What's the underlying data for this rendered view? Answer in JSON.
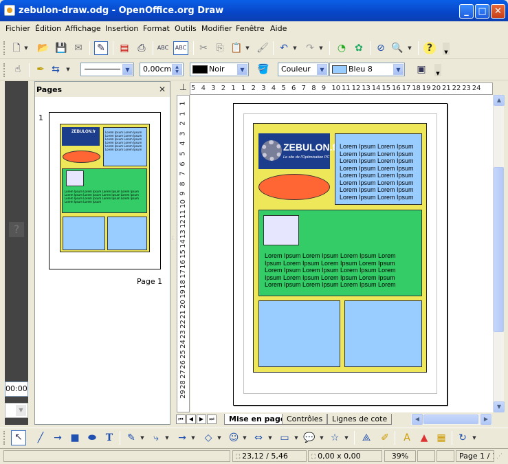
{
  "window": {
    "title": "zebulon-draw.odg - OpenOffice.org Draw",
    "buttons": {
      "minimize": "_",
      "maximize": "□",
      "close": "✕"
    }
  },
  "menu": [
    "Fichier",
    "Édition",
    "Affichage",
    "Insertion",
    "Format",
    "Outils",
    "Modifier",
    "Fenêtre",
    "Aide"
  ],
  "line_toolbar": {
    "line_width": "0,00cm",
    "line_color": {
      "label": "Noir",
      "color": "#000000"
    },
    "fill_type": "Couleur",
    "fill_color": {
      "label": "Bleu 8",
      "color": "#99ccff"
    }
  },
  "left_panel": {
    "partial_value": "00:00"
  },
  "pages_panel": {
    "title": "Pages",
    "close": "✕",
    "page_number": "1",
    "page_label": "Page 1"
  },
  "rulers": {
    "horizontal": [
      "5",
      "4",
      "3",
      "2",
      "1",
      "1",
      "2",
      "3",
      "4",
      "5",
      "6",
      "7",
      "8",
      "9",
      "10",
      "11",
      "12",
      "13",
      "14",
      "15",
      "16",
      "17",
      "18",
      "19",
      "20",
      "21",
      "22",
      "23",
      "24"
    ],
    "vertical": [
      "1",
      "1",
      "2",
      "3",
      "4",
      "5",
      "6",
      "7",
      "8",
      "9",
      "10",
      "11",
      "12",
      "13",
      "14",
      "15",
      "16",
      "17",
      "18",
      "19",
      "20",
      "21",
      "22",
      "23",
      "24",
      "25",
      "26",
      "27",
      "28",
      "29"
    ]
  },
  "document": {
    "logo_text": "ZEBULON.fr",
    "logo_tagline": "Le site de l'Optimisation PC",
    "lorem_right": [
      "Lorem Ipsum Lorem Ipsum",
      "Lorem Ipsum Lorem Ipsum",
      "Lorem Ipsum Lorem Ipsum",
      "Lorem Ipsum Lorem Ipsum",
      "Lorem Ipsum Lorem Ipsum",
      "Lorem Ipsum Lorem Ipsum",
      "Lorem Ipsum Lorem Ipsum",
      "Lorem Ipsum Lorem Ipsum"
    ],
    "lorem_green": [
      "Lorem Ipsum Lorem Ipsum Lorem Ipsum Lorem",
      "Ipsum Lorem Ipsum Lorem Ipsum Lorem Ipsum",
      "Lorem Ipsum Lorem Ipsum Lorem Ipsum Lorem",
      "Ipsum Lorem Ipsum Lorem Ipsum Lorem Ipsum",
      "Lorem Ipsum Lorem Ipsum Lorem Ipsum Lorem"
    ],
    "colors": {
      "background_box": "#efe75a",
      "blue_box": "#99ccff",
      "green_box": "#33cc66",
      "ellipse": "#ff6633",
      "small_square": "#e6e6ff",
      "logo": "#1c3c8c"
    }
  },
  "sheet_tabs": [
    "Mise en page",
    "Contrôles",
    "Lignes de cote"
  ],
  "status": {
    "position": "23,12 / 5,46",
    "size": "0,00 x 0,00",
    "zoom": "39%",
    "page": "Page 1 / 1"
  }
}
